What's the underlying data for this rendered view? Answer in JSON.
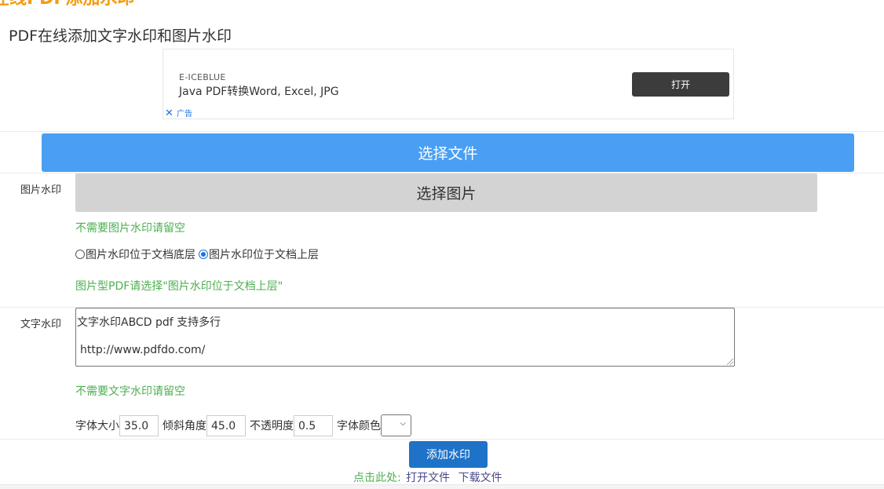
{
  "site_title": "在线PDF添加水印",
  "page_title": "PDF在线添加文字水印和图片水印",
  "ad": {
    "brand": "E-ICEBLUE",
    "headline": "Java PDF转换Word, Excel, JPG",
    "open_label": "打开",
    "ad_label": "广告",
    "close_glyph": "✕"
  },
  "choose_file_label": "选择文件",
  "image_watermark": {
    "label": "图片水印",
    "choose_label": "选择图片",
    "hint_empty": "不需要图片水印请留空",
    "option_bottom": "图片水印位于文档底层",
    "option_top": "图片水印位于文档上层",
    "selected": "option_top",
    "hint_image_pdf": "图片型PDF请选择\"图片水印位于文档上层\""
  },
  "text_watermark": {
    "label": "文字水印",
    "line1": "文字水印ABCD pdf 支持多行",
    "line2": "http://www.pdfdo.com/",
    "hint_empty": "不需要文字水印请留空"
  },
  "settings": {
    "font_size_label": "字体大小",
    "font_size_value": "35.0",
    "angle_label": "倾斜角度",
    "angle_value": "45.0",
    "opacity_label": "不透明度",
    "opacity_value": "0.5",
    "color_label": "字体颜色"
  },
  "add_button_label": "添加水印",
  "links": {
    "prefix": "点击此处:",
    "open_file": "打开文件",
    "download_file": "下载文件"
  },
  "colors": {
    "brand_orange": "#f39c12",
    "primary_blue": "#4a9ff5",
    "action_blue": "#1e73c8",
    "hint_green": "#4caf50",
    "ad_button": "#3c3c3c"
  }
}
